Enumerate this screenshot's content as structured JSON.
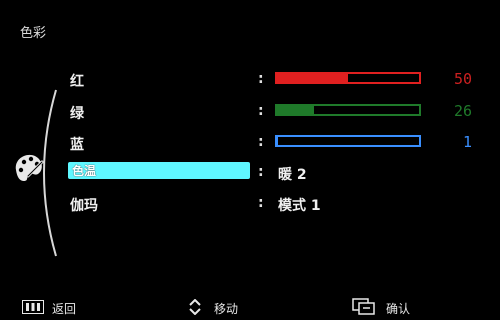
{
  "menu": {
    "title": "色彩"
  },
  "items": [
    {
      "label": "红",
      "value": "50",
      "fraction": 0.5,
      "color": "#e02020",
      "num_color": "#cc2020"
    },
    {
      "label": "绿",
      "value": "26",
      "fraction": 0.26,
      "color": "#1f7a2a",
      "num_color": "#1f7a2a"
    },
    {
      "label": "蓝",
      "value": "1",
      "fraction": 0.01,
      "color": "#3a8fff",
      "num_color": "#3a8fff"
    }
  ],
  "color_temp": {
    "label": "色温",
    "value": "暖 2"
  },
  "gamma": {
    "label": "伽玛",
    "value": "模式 1"
  },
  "separator": ":",
  "footer": {
    "back_label": "返回",
    "move_label": "移动",
    "confirm_label": "确认"
  },
  "icons": {
    "category": "palette-icon",
    "back": "menu-bars-icon",
    "move": "up-down-arrow-icon",
    "confirm": "enter-icon"
  }
}
